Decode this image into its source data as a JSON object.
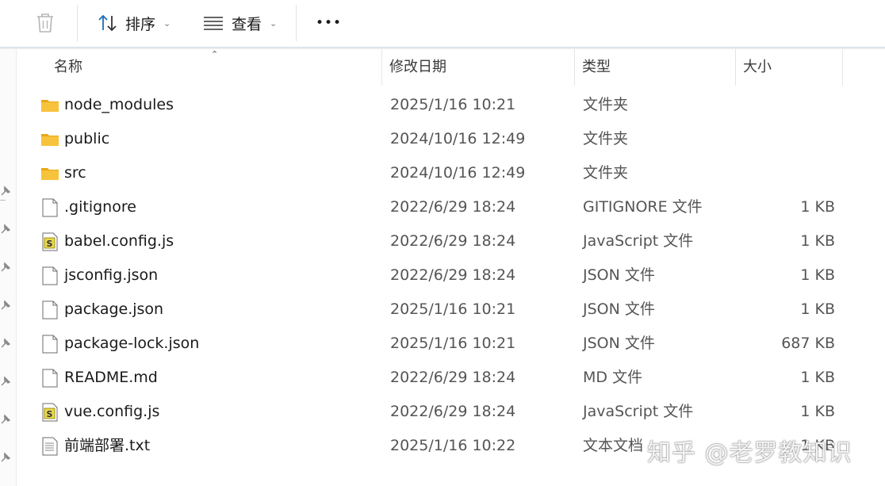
{
  "toolbar": {
    "sort_label": "排序",
    "view_label": "查看",
    "more_label": "•••"
  },
  "columns": {
    "name": "名称",
    "date": "修改日期",
    "type": "类型",
    "size": "大小"
  },
  "files": [
    {
      "name": "node_modules",
      "date": "2025/1/16 10:21",
      "type": "文件夹",
      "size": "",
      "icon": "folder-icon"
    },
    {
      "name": "public",
      "date": "2024/10/16 12:49",
      "type": "文件夹",
      "size": "",
      "icon": "folder-icon"
    },
    {
      "name": "src",
      "date": "2024/10/16 12:49",
      "type": "文件夹",
      "size": "",
      "icon": "folder-icon"
    },
    {
      "name": ".gitignore",
      "date": "2022/6/29 18:24",
      "type": "GITIGNORE 文件",
      "size": "1 KB",
      "icon": "file-icon"
    },
    {
      "name": "babel.config.js",
      "date": "2022/6/29 18:24",
      "type": "JavaScript 文件",
      "size": "1 KB",
      "icon": "js-file-icon"
    },
    {
      "name": "jsconfig.json",
      "date": "2022/6/29 18:24",
      "type": "JSON 文件",
      "size": "1 KB",
      "icon": "file-icon"
    },
    {
      "name": "package.json",
      "date": "2025/1/16 10:21",
      "type": "JSON 文件",
      "size": "1 KB",
      "icon": "file-icon"
    },
    {
      "name": "package-lock.json",
      "date": "2025/1/16 10:21",
      "type": "JSON 文件",
      "size": "687 KB",
      "icon": "file-icon"
    },
    {
      "name": "README.md",
      "date": "2022/6/29 18:24",
      "type": "MD 文件",
      "size": "1 KB",
      "icon": "file-icon"
    },
    {
      "name": "vue.config.js",
      "date": "2022/6/29 18:24",
      "type": "JavaScript 文件",
      "size": "1 KB",
      "icon": "js-file-icon"
    },
    {
      "name": "前端部署.txt",
      "date": "2025/1/16 10:22",
      "type": "文本文档",
      "size": "1 KB",
      "icon": "text-file-icon"
    }
  ],
  "watermark": "知乎 @老罗教知识",
  "colors": {
    "folder": "#f7c33c",
    "folder_dark": "#e6a817",
    "sort_icon": "#1e6bb8"
  }
}
